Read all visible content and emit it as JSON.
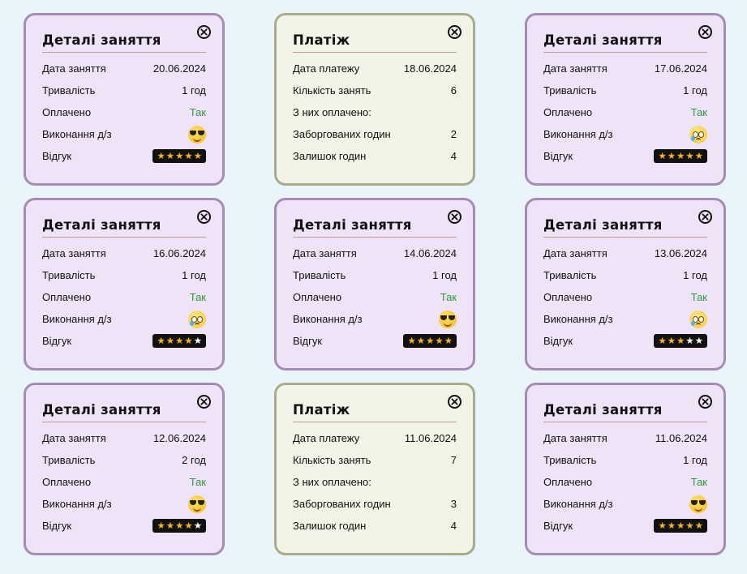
{
  "labels": {
    "lesson_title": "Деталі заняття",
    "payment_title": "Платіж",
    "lesson_date": "Дата заняття",
    "duration": "Тривалість",
    "paid": "Оплачено",
    "homework": "Виконання д/з",
    "review": "Відгук",
    "payment_date": "Дата платежу",
    "lessons_count": "Кількість занять",
    "of_them_paid": "З них оплачено:",
    "owed_hours": "Заборгованих годин",
    "remaining_hours": "Залишок годин"
  },
  "cards": [
    {
      "kind": "lesson",
      "date": "20.06.2024",
      "duration": "1 год",
      "paid": "Так",
      "homework_icon": "smiling-face-with-sunglasses-icon",
      "rating": 5
    },
    {
      "kind": "payment",
      "date": "18.06.2024",
      "lessons_count": "6",
      "of_them_paid": "",
      "owed_hours": "2",
      "remaining_hours": "4"
    },
    {
      "kind": "lesson",
      "date": "17.06.2024",
      "duration": "1 год",
      "paid": "Так",
      "homework_icon": "face-holding-back-tears-icon",
      "rating": 5
    },
    {
      "kind": "lesson",
      "date": "16.06.2024",
      "duration": "1 год",
      "paid": "Так",
      "homework_icon": "face-holding-back-tears-icon",
      "rating": 4
    },
    {
      "kind": "lesson",
      "date": "14.06.2024",
      "duration": "1 год",
      "paid": "Так",
      "homework_icon": "smiling-face-with-sunglasses-icon",
      "rating": 5
    },
    {
      "kind": "lesson",
      "date": "13.06.2024",
      "duration": "1 год",
      "paid": "Так",
      "homework_icon": "face-holding-back-tears-icon",
      "rating": 3
    },
    {
      "kind": "lesson",
      "date": "12.06.2024",
      "duration": "2 год",
      "paid": "Так",
      "homework_icon": "smiling-face-with-sunglasses-icon",
      "rating": 4
    },
    {
      "kind": "payment",
      "date": "11.06.2024",
      "lessons_count": "7",
      "of_them_paid": "",
      "owed_hours": "3",
      "remaining_hours": "4"
    },
    {
      "kind": "lesson",
      "date": "11.06.2024",
      "duration": "1 год",
      "paid": "Так",
      "homework_icon": "smiling-face-with-sunglasses-icon",
      "rating": 5
    }
  ],
  "colors": {
    "lesson_bg": "#efe3f8",
    "lesson_border": "#a58bb5",
    "payment_bg": "#f1f4e6",
    "payment_border": "#a9ac8a",
    "paid_yes": "#2d9a3a",
    "star_on": "#f5b21a",
    "star_off": "#ffffff",
    "page_bg": "#eaf4fb"
  },
  "rating_max": 5
}
